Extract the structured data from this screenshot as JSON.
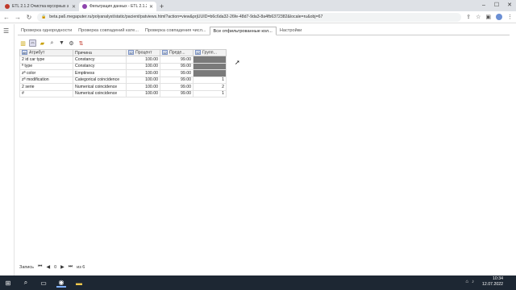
{
  "browser": {
    "tabs": [
      {
        "title": "ETL 2.1.2 Очистка мусорных з",
        "favicon_color": "#c0392b"
      },
      {
        "title": "Фильтрация данных - ETL 2.1.2",
        "favicon_color": "#8e44ad"
      }
    ],
    "new_tab": "+",
    "url": "beta.pa6.megaputer.ru/polyanalyst/static/pacient/patviews.html?action=view&prjUUID=b6c6da32-26fe-48d7-9da3-8a4fb6372382&locale=ru&obj=67"
  },
  "app": {
    "tabs": [
      {
        "label": "Проверка однородности",
        "active": false
      },
      {
        "label": "Проверка совпадений кате...",
        "active": false
      },
      {
        "label": "Проверка совпадения числ...",
        "active": false
      },
      {
        "label": "Все отфильтрованные кол...",
        "active": true
      },
      {
        "label": "Настройки",
        "active": false
      }
    ],
    "table": {
      "headers": [
        "Атрибут",
        "Причина",
        "Процент",
        "Преде...",
        "Групп..."
      ],
      "header_icons": [
        "ab",
        "",
        "12",
        "12",
        "12"
      ],
      "rows": [
        {
          "attr": "2 id car type",
          "reason": "Constancy",
          "pct": "100.00",
          "limit": "99.00",
          "group": "",
          "grey": true
        },
        {
          "attr": "ª type",
          "reason": "Constancy",
          "pct": "100.00",
          "limit": "99.00",
          "group": "",
          "grey": true
        },
        {
          "attr": "zª color",
          "reason": "Emptiness",
          "pct": "100.00",
          "limit": "99.00",
          "group": "",
          "grey": true
        },
        {
          "attr": "zª modification",
          "reason": "Categorical coincidence",
          "pct": "100.00",
          "limit": "99.00",
          "group": "1",
          "grey": false
        },
        {
          "attr": "2 serie",
          "reason": "Numerical coincidence",
          "pct": "100.00",
          "limit": "99.00",
          "group": "2",
          "grey": false
        },
        {
          "attr": "#",
          "reason": "Numerical coincidence",
          "pct": "100.00",
          "limit": "99.00",
          "group": "1",
          "grey": false
        }
      ]
    },
    "pager": {
      "label": "Запись",
      "current": "0",
      "of_text": "из 6"
    }
  },
  "taskbar": {
    "time": "10:34",
    "date": "12.07.2022"
  }
}
